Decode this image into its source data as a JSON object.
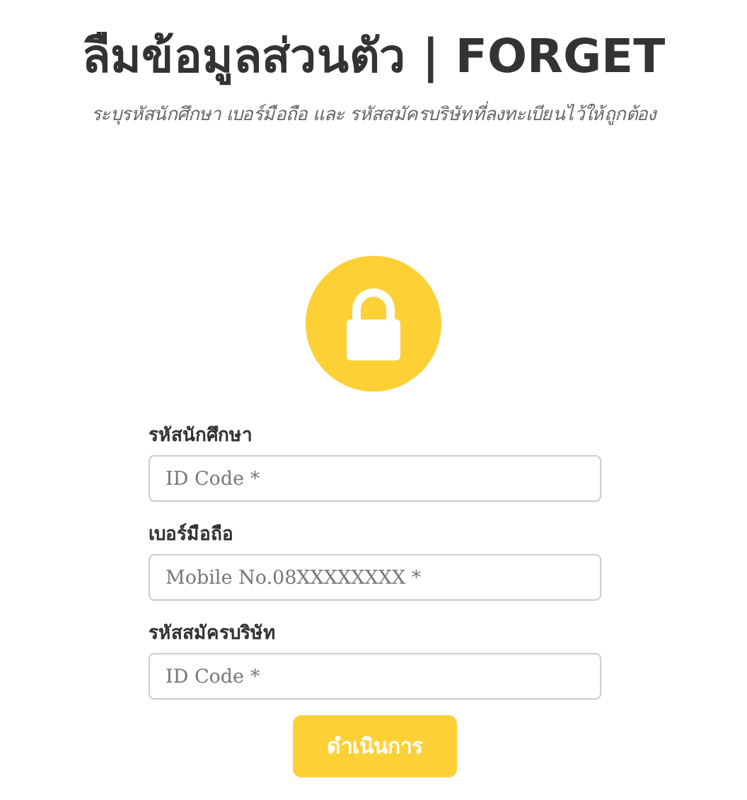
{
  "title": "ลืมข้อมูลส่วนตัว | FORGET",
  "subtitle": "ระบุรหัสนักศึกษา เบอร์มือถือ และ รหัสสมัครบริษัทที่ลงทะเบียนไว้ให้ถูกต้อง",
  "fields": [
    {
      "label": "รหัสนักศึกษา",
      "placeholder": "ID Code *"
    },
    {
      "label": "เบอร์มือถือ",
      "placeholder": "Mobile No.08XXXXXXXX *"
    },
    {
      "label": "รหัสสมัครบริษัท",
      "placeholder": "ID Code *"
    }
  ],
  "submit_button": "ดำเนินการ"
}
